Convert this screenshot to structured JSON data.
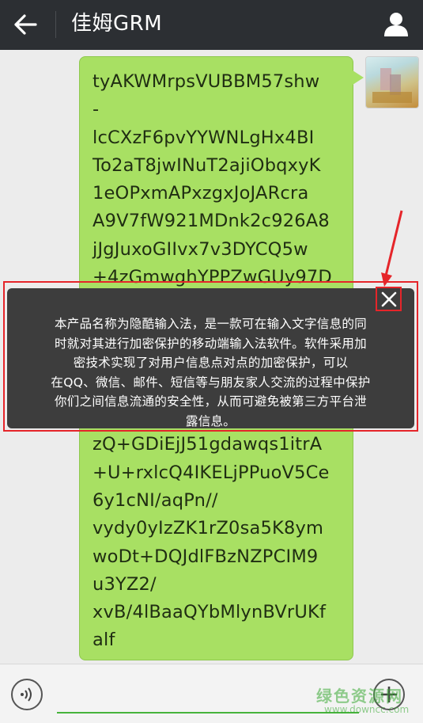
{
  "header": {
    "title": "佳姆GRM",
    "back_icon": "arrow-left-icon",
    "profile_icon": "person-icon"
  },
  "chat": {
    "message_top_lines": [
      "tyAKWMrpsVUBBM57shw",
      "-",
      "lcCXzF6pvYYWNLgHx4BI",
      "To2aT8jwINuT2ajiObqxyK",
      "1eOPxmAPxzgxJoJARcra",
      "A9V7fW921MDnk2c926A8",
      "jJgJuxoGIIvx7v3DYCQ5w",
      "+4zGmwghYPPZwGUy97D"
    ],
    "message_bottom_lines": [
      "zQ+GDiEjJ51gdawqs1itrA",
      "+U+rxlcQ4IKELjPPuoV5Ce",
      "6y1cNI/aqPn//",
      "vydy0yIzZK1rZ0sa5K8ym",
      "woDt+DQJdlFBzNZPCIM9",
      "u3YZ2/",
      "xvB/4lBaaQYbMlynBVrUKf",
      "alf"
    ],
    "bubble_color": "#a8e063"
  },
  "popup": {
    "lines": [
      "本产品名称为隐酷输入法，是一款可在输入文字信息的同",
      "时就对其进行加密保护的移动端输入法软件。软件采用加",
      "密技术实现了对用户信息点对点的加密保护，可以",
      "在QQ、微信、邮件、短信等与朋友家人交流的过程中保护",
      "你们之间信息流通的安全性，从而可避免被第三方平台泄",
      "露信息。"
    ],
    "close_icon": "close-icon",
    "highlight_color": "#e5252a"
  },
  "bottom": {
    "voice_icon": "voice-icon",
    "plus_icon": "plus-icon",
    "input_value": "",
    "accent_color": "#46b33b"
  },
  "watermark": {
    "main": "绿色资源网",
    "sub": "www.downcc.com"
  }
}
